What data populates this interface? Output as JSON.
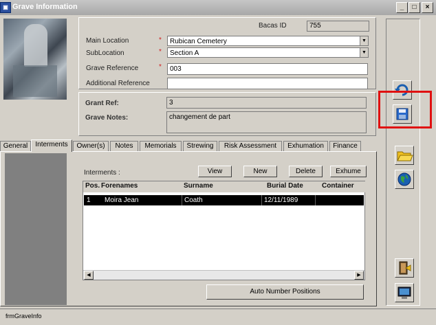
{
  "window": {
    "title": "Grave Information",
    "app_icon": "app-icon",
    "minimize": "_",
    "maximize": "□",
    "close": "×"
  },
  "header": {
    "bacas_id_label": "Bacas ID",
    "bacas_id_value": "755",
    "main_location_label": "Main Location",
    "main_location_value": "Rubican Cemetery",
    "sublocation_label": "SubLocation",
    "sublocation_value": "Section A",
    "grave_reference_label": "Grave Reference",
    "grave_reference_value": "003",
    "additional_reference_label": "Additional Reference",
    "additional_reference_value": "",
    "required_marker": "*"
  },
  "grant": {
    "grant_ref_label": "Grant Ref:",
    "grant_ref_value": "3",
    "grave_notes_label": "Grave Notes:",
    "grave_notes_value": "changement de part"
  },
  "tabs": [
    {
      "label": "General"
    },
    {
      "label": "Interments",
      "active": true
    },
    {
      "label": "Owner(s)"
    },
    {
      "label": "Notes"
    },
    {
      "label": "Memorials"
    },
    {
      "label": "Strewing"
    },
    {
      "label": "Risk Assessment"
    },
    {
      "label": "Exhumation"
    },
    {
      "label": "Finance"
    }
  ],
  "interments": {
    "section_label": "Interments :",
    "view_button": "View",
    "new_button": "New",
    "delete_button": "Delete",
    "exhume_button": "Exhume",
    "columns": [
      "Pos.",
      "Forenames",
      "Surname",
      "Burial Date",
      "Container"
    ],
    "rows": [
      {
        "pos": "1",
        "forenames": "Moira Jean",
        "surname": "Coath",
        "burial_date": "12/11/1989",
        "container": ""
      }
    ],
    "auto_number_button": "Auto Number Positions"
  },
  "status_bar": {
    "form_name": "frmGraveInfo"
  },
  "side_toolbar": [
    "undo-icon",
    "save-icon",
    "open-folder-icon",
    "globe-icon",
    "exit-door-icon",
    "monitor-icon"
  ],
  "colors": {
    "highlight_box": "#e01010",
    "selected_row": "#000000",
    "folder": "#f0c020",
    "globe": "#1a5fb0"
  }
}
